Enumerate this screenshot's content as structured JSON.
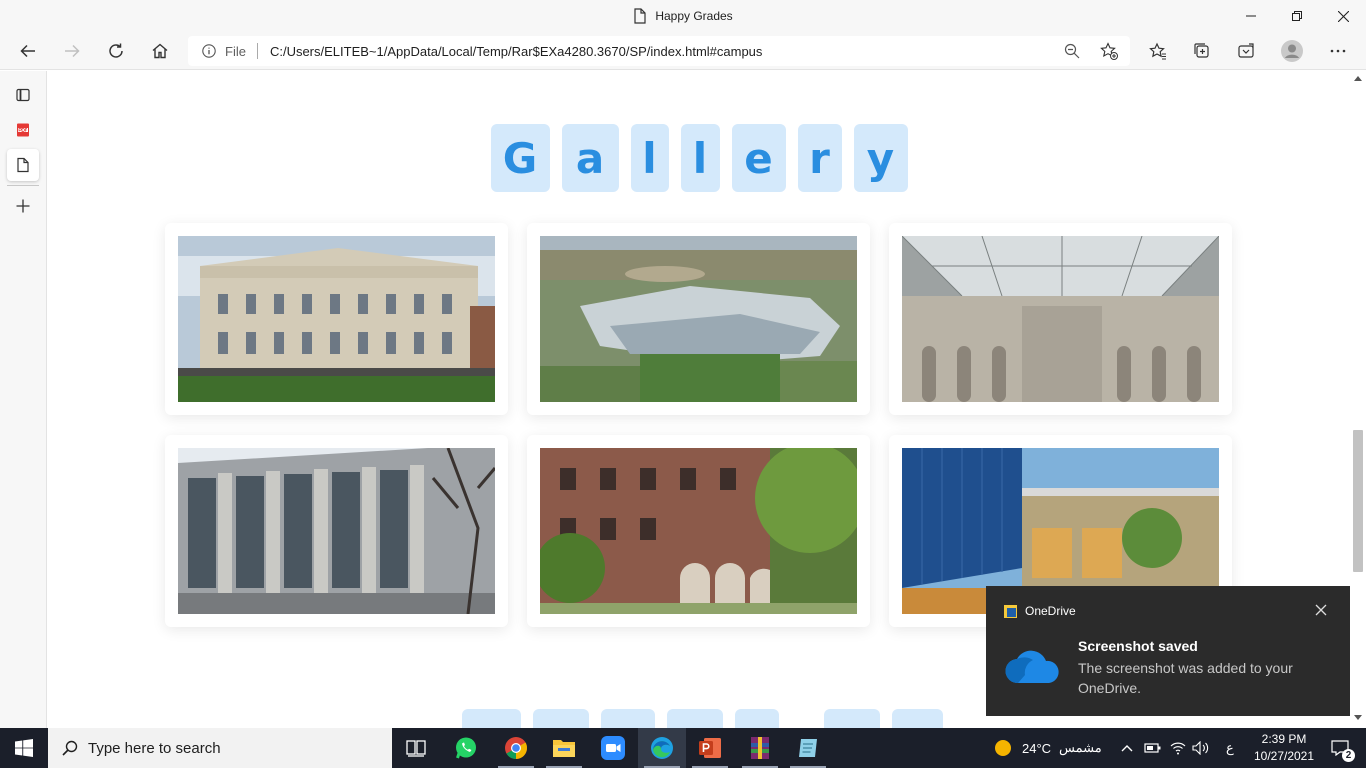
{
  "window": {
    "title": "Happy Grades"
  },
  "nav": {
    "file_label": "File",
    "url": "C:/Users/ELITEB~1/AppData/Local/Temp/Rar$EXa4280.3670/SP/index.html#campus"
  },
  "gallery": {
    "letters": [
      "G",
      "a",
      "l",
      "l",
      "e",
      "r",
      "y"
    ]
  },
  "toast": {
    "app_name": "OneDrive",
    "title": "Screenshot saved",
    "body": "The screenshot was added to your OneDrive."
  },
  "taskbar": {
    "search_placeholder": "Type here to search",
    "weather_temp": "24°C",
    "weather_text": "مشمس",
    "language": "ع",
    "time": "2:39 PM",
    "date": "10/27/2021",
    "notification_count": "2"
  },
  "colors": {
    "accent": "#2a8ee0",
    "letter_tile": "#d4e9fb",
    "taskbar": "#1b1f2a",
    "toast": "#2b2b2b"
  }
}
